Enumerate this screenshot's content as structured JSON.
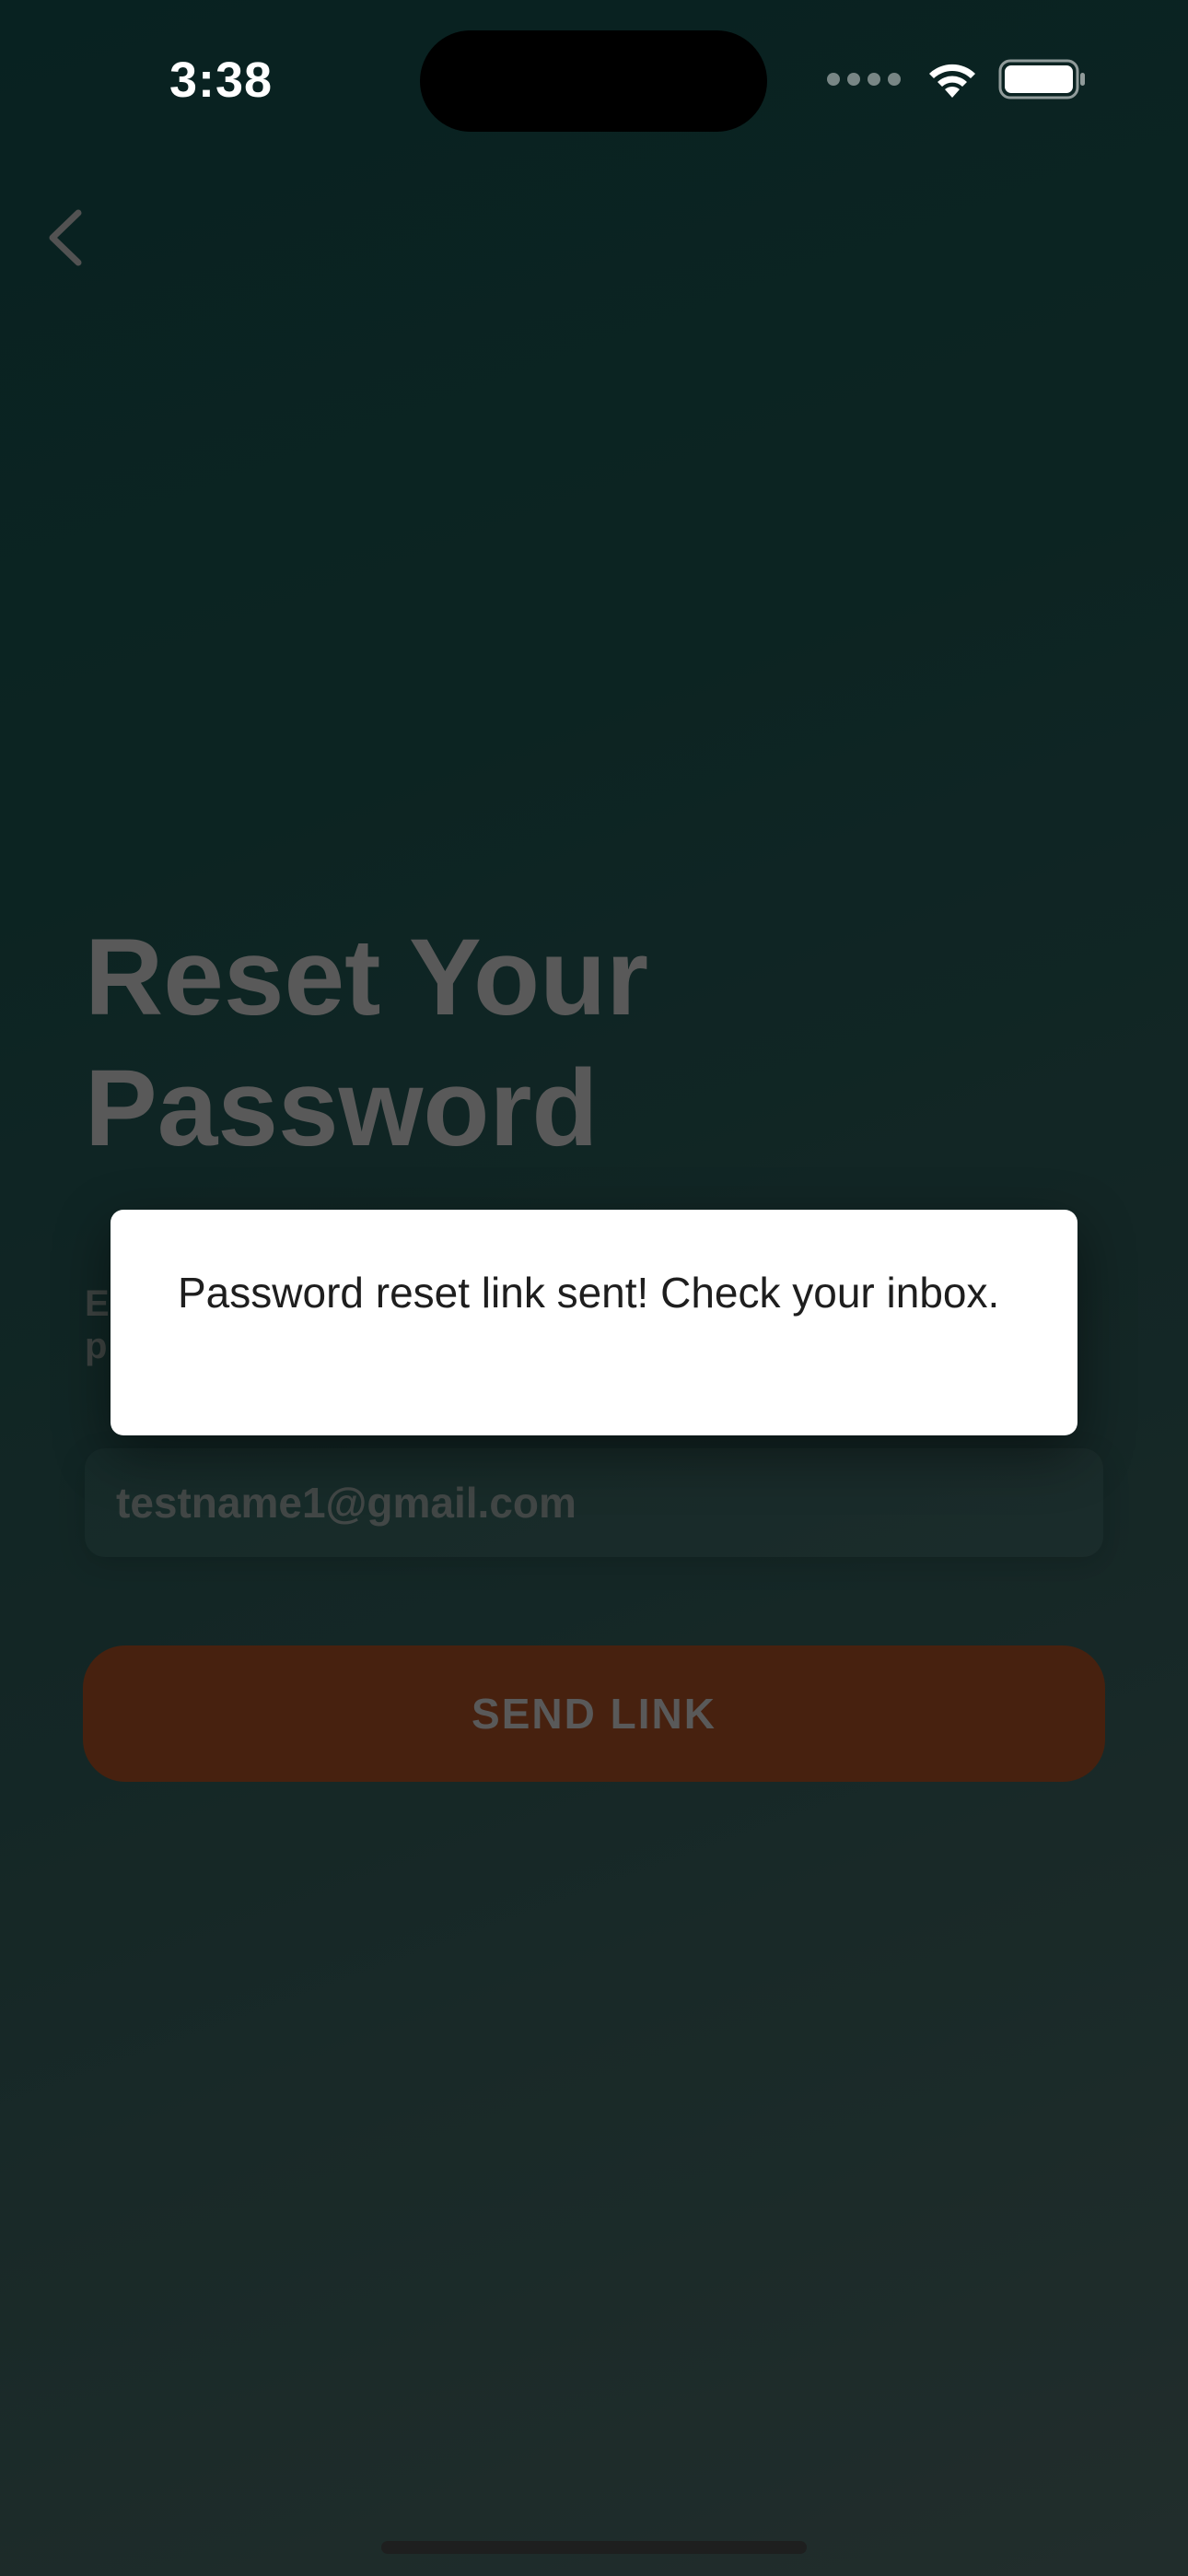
{
  "status_bar": {
    "time": "3:38",
    "icons": [
      "signal-dots-icon",
      "wifi-icon",
      "battery-icon"
    ]
  },
  "nav": {
    "back_icon": "chevron-left-icon"
  },
  "reset": {
    "title_line1": "Reset Your",
    "title_line2": "Password",
    "subtitle_line1": "E",
    "subtitle_line2": "p",
    "email_value": "testname1@gmail.com",
    "send_label": "SEND LINK"
  },
  "toast": {
    "message": "Password reset link sent! Check your inbox."
  },
  "colors": {
    "accent_button": "#7a3a1a",
    "background_top": "#0f3b39",
    "background_bottom": "#3a4f4c"
  }
}
